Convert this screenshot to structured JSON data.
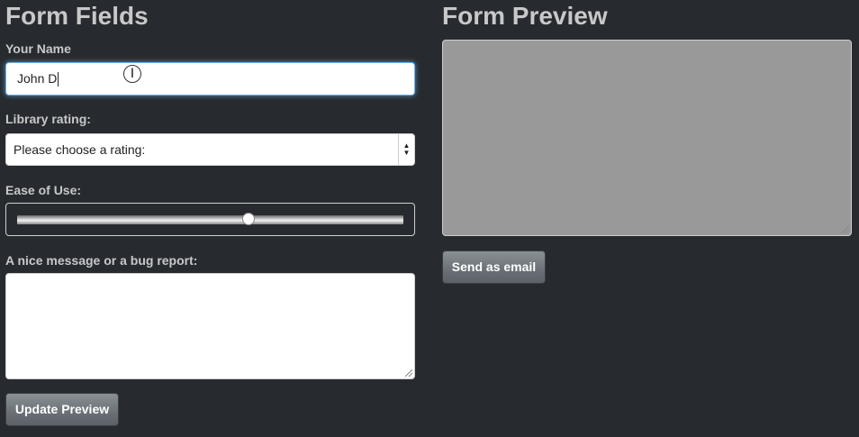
{
  "form_fields": {
    "title": "Form Fields",
    "name_label": "Your Name",
    "name_value": "John D",
    "rating_label": "Library rating:",
    "rating_selected": "Please choose a rating:",
    "ease_label": "Ease of Use:",
    "ease_value": 0.6,
    "message_label": "A nice message or a bug report:",
    "message_value": "",
    "update_button": "Update Preview"
  },
  "form_preview": {
    "title": "Form Preview",
    "preview_text": "",
    "send_button": "Send as email"
  },
  "icons": {
    "cursor": "text-cursor-icon",
    "select_arrows": "up-down-arrows-icon",
    "resize": "resize-grip-icon"
  },
  "colors": {
    "background": "#272b30",
    "label": "#c8c8c8",
    "focus": "#66afe9",
    "preview_bg": "#999999"
  }
}
